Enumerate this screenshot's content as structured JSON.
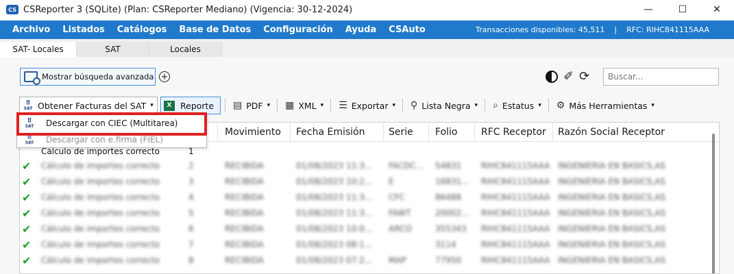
{
  "window": {
    "title": "CSReporter 3 (SQLite) (Plan: CSReporter Mediano) (Vigencia: 30-12-2024)",
    "app_icon": "cs-logo-icon",
    "controls": [
      "—",
      "☐",
      "✕"
    ]
  },
  "menu": {
    "items": [
      "Archivo",
      "Listados",
      "Catálogos",
      "Base de Datos",
      "Configuración",
      "Ayuda",
      "CSAuto"
    ],
    "transactions": "Transacciones disponibles: 45,511",
    "separator": "|",
    "rfc": "RFC: RIHC841115AAA"
  },
  "tabs": [
    "SAT- Locales",
    "SAT",
    "Locales"
  ],
  "toolbar_top": {
    "advanced_search": "Mostrar búsqueda avanzada",
    "plus": "+",
    "search_placeholder": "Buscar..."
  },
  "toolbar": {
    "sat_button": "Obtener Facturas del SAT",
    "sat_logo": "SAT",
    "xls": "X",
    "reporte": "Reporte",
    "pdf": "PDF",
    "xml": "XML",
    "exportar": "Exportar",
    "lista_negra": "Lista Negra",
    "estatus": "Estatus",
    "mas": "Más Herramientas",
    "caret": "▾"
  },
  "dropdown": {
    "items": [
      {
        "label": "Descargar con CIEC (Multitarea)"
      },
      {
        "label": "Descargar con e.firma (FIEL)"
      }
    ]
  },
  "grid": {
    "columns": [
      "Movimiento",
      "Fecha Emisión",
      "Serie",
      "Folio",
      "RFC Receptor",
      "Razón Social Receptor"
    ],
    "first_row": {
      "status": "Cálculo de importes correcto",
      "num": "1"
    },
    "rows": [
      {
        "status": "Cálculo de importes correcto",
        "num": "2",
        "mov": "RECIBIDA",
        "fecha": "01/08/2023 11:3...",
        "serie": "FACDC...",
        "folio": "54831",
        "rfc": "RIHC841115AAA",
        "razon": "INGENIERIA EN BASICS,AS"
      },
      {
        "status": "Cálculo de importes correcto",
        "num": "3",
        "mov": "RECIBIDA",
        "fecha": "01/08/2023 10:2...",
        "serie": "E",
        "folio": "16831...",
        "rfc": "RIHC841115AAA",
        "razon": "INGENIERIA EN BASICS,AS"
      },
      {
        "status": "Cálculo de importes correcto",
        "num": "4",
        "mov": "RECIBIDA",
        "fecha": "01/08/2023 11:3...",
        "serie": "CFC",
        "folio": "86488",
        "rfc": "RIHC841115AAA",
        "razon": "INGENIERIA EN BASICS,AS"
      },
      {
        "status": "Cálculo de importes correcto",
        "num": "5",
        "mov": "RECIBIDA",
        "fecha": "01/08/2023 11:3...",
        "serie": "FAWT",
        "folio": "20002...",
        "rfc": "RIHC841115AAA",
        "razon": "INGENIERIA EN BASICS,AS"
      },
      {
        "status": "Cálculo de importes correcto",
        "num": "6",
        "mov": "RECIBIDA",
        "fecha": "01/08/2023 10:0...",
        "serie": "ARCO",
        "folio": "355343",
        "rfc": "RIHC841115AAA",
        "razon": "INGENIERIA EN BASICS,AS"
      },
      {
        "status": "Cálculo de importes correcto",
        "num": "7",
        "mov": "RECIBIDA",
        "fecha": "01/08/2023 08:1...",
        "serie": "",
        "folio": "3114",
        "rfc": "RIHC841115AAA",
        "razon": "INGENIERIA EN BASICS,AS"
      },
      {
        "status": "Cálculo de importes correcto",
        "num": "8",
        "mov": "RECIBIDA",
        "fecha": "01/08/2023 07:2...",
        "serie": "MAP",
        "folio": "77950",
        "rfc": "RIHC841115AAA",
        "razon": "INGENIERIA EN BASICS,AS"
      }
    ],
    "check": "✔"
  },
  "colors": {
    "menubar": "#1f7acb",
    "highlight": "#e02020",
    "check": "#22a02c"
  }
}
